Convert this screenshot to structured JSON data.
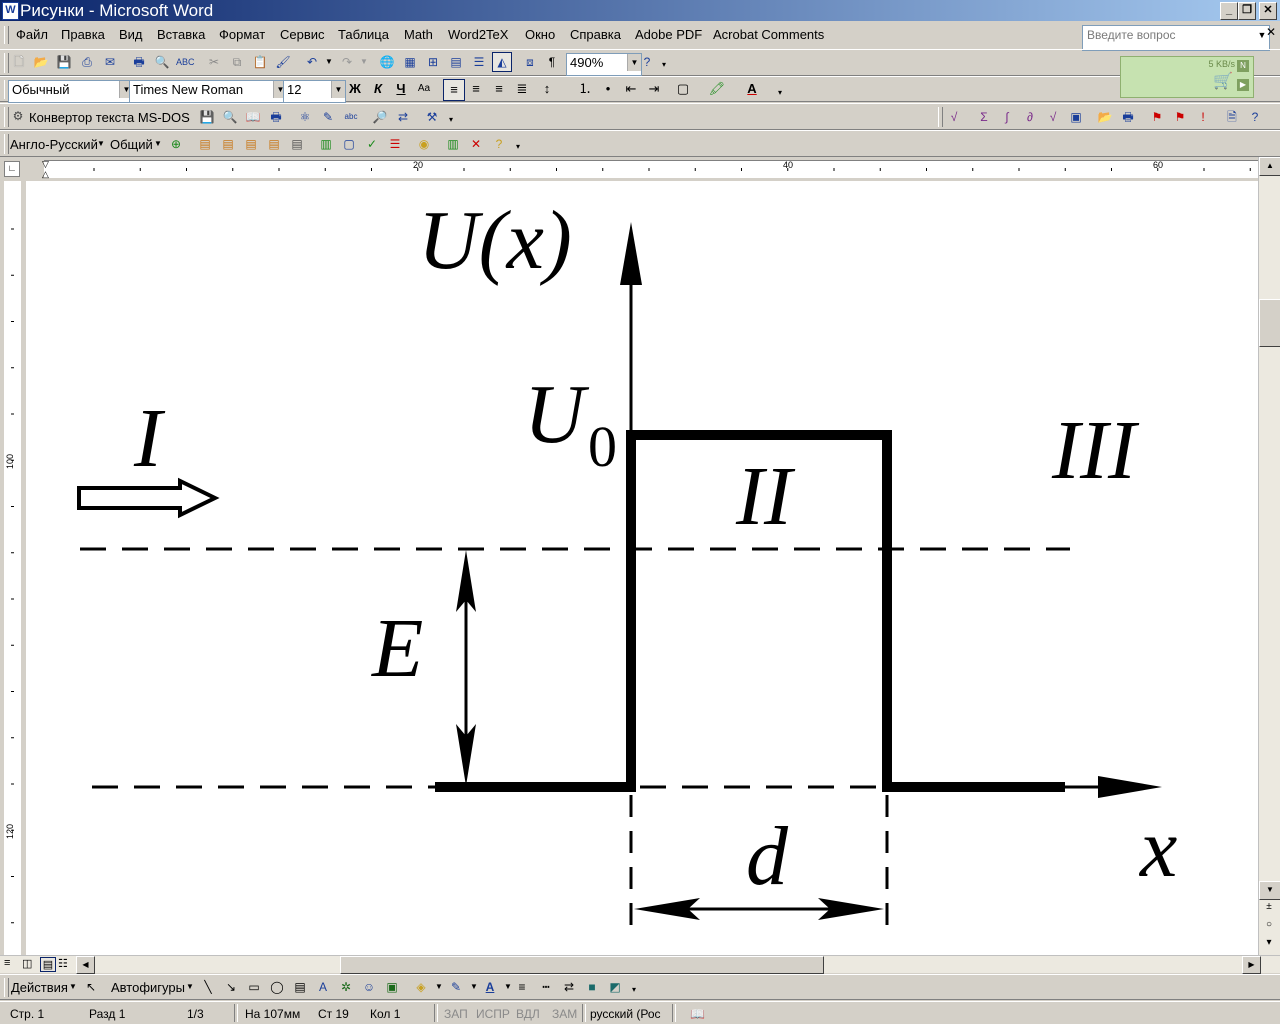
{
  "window": {
    "title": "Рисунки - Microsoft Word",
    "icon_letter": "W"
  },
  "menu": [
    "Файл",
    "Правка",
    "Вид",
    "Вставка",
    "Формат",
    "Сервис",
    "Таблица",
    "Math",
    "Word2TeX",
    "Окно",
    "Справка",
    "Adobe PDF",
    "Acrobat Comments"
  ],
  "help_placeholder": "Введите вопрос",
  "toolbar": {
    "zoom": "490%",
    "style": "Обычный",
    "font": "Times New Roman",
    "size": "12",
    "bold": "Ж",
    "italic": "К",
    "underline": "Ч",
    "converter_label": "Конвертор текста MS-DOS",
    "dict_direction": "Англо-Русский",
    "dict_topic": "Общий"
  },
  "netmeter": {
    "speed": "5 KB/s"
  },
  "ruler": {
    "h_labels": [
      "20",
      "40",
      "60"
    ],
    "v_labels": [
      "100",
      "120"
    ]
  },
  "drawing": {
    "title": "U(x)",
    "u0_main": "U",
    "u0_sub": "0",
    "region1": "I",
    "region2": "II",
    "region3": "III",
    "energy": "E",
    "width": "d",
    "axis_x": "x"
  },
  "drawbar": {
    "actions": "Действия",
    "autoshapes": "Автофигуры"
  },
  "status": {
    "page": "Стр. 1",
    "section": "Разд 1",
    "pages": "1/3",
    "at": "На 107мм",
    "line": "Ст 19",
    "col": "Кол 1",
    "rec": "ЗАП",
    "trk": "ИСПР",
    "ext": "ВДЛ",
    "ovr": "ЗАМ",
    "lang": "русский (Рос"
  }
}
